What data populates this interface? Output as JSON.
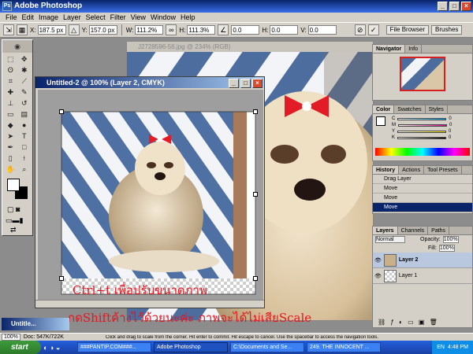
{
  "window": {
    "title": "Adobe Photoshop"
  },
  "menu": [
    "File",
    "Edit",
    "Image",
    "Layer",
    "Select",
    "Filter",
    "View",
    "Window",
    "Help"
  ],
  "options": {
    "x": "187.5 px",
    "y": "157.0 px",
    "w": "111.2%",
    "h": "111.3%",
    "angle": "0.0",
    "hskew": "0.0",
    "vskew": "0.0",
    "labels": {
      "x": "X:",
      "y": "Y:",
      "w": "W:",
      "h": "H:",
      "h_skew": "H:",
      "v_skew": "V:"
    },
    "tabs": [
      "File Browser",
      "Brushes"
    ]
  },
  "documents": {
    "background_title": "J2728596-56.jpg @ 234% (RGB)",
    "front_title": "Untitled-2 @ 100% (Layer 2, CMYK)",
    "minimized_title": "Untitle..."
  },
  "panels": {
    "navigator_tabs": [
      "Navigator",
      "Info"
    ],
    "color_tabs": [
      "Color",
      "Swatches",
      "Styles"
    ],
    "color_channels": [
      {
        "label": "C",
        "value": "0",
        "color": "#00a6e0"
      },
      {
        "label": "M",
        "value": "0",
        "color": "#e0008a"
      },
      {
        "label": "Y",
        "value": "0",
        "color": "#f0e000"
      },
      {
        "label": "K",
        "value": "0",
        "color": "#000000"
      }
    ],
    "history_tabs": [
      "History",
      "Actions",
      "Tool Presets"
    ],
    "history": [
      "Drag Layer",
      "Move",
      "Move",
      "Move"
    ],
    "layers_tabs": [
      "Layers",
      "Channels",
      "Paths"
    ],
    "blend_mode": "Normal",
    "opacity_label": "Opacity:",
    "opacity": "100%",
    "fill_label": "Fill:",
    "fill": "100%",
    "layers": [
      "Layer 2",
      "Layer 1"
    ]
  },
  "overlay": {
    "line1": "Ctrl+t เพื่อปรับขนาดภาพ",
    "line2": "กดShiftค้างไว้ด้วยนะค่ะ ภาพจะได้ไม่เสียScale"
  },
  "statusbar": {
    "zoom": "100%",
    "doc": "Doc: 547K/722K",
    "hint": "Click and drag to scale from the corner. Hit enter to commit. Hit escape to cancel. Use the spacebar to access the navigation tools."
  },
  "taskbar": {
    "start": "start",
    "items": [
      "###PANTIP.COM###...",
      "Adobe Photoshop",
      "C:\\Documents and Se...",
      "249. THE INNOCENT ..."
    ],
    "active_index": 1,
    "lang": "EN",
    "time": "4:48 PM"
  },
  "colors": {
    "accent": "#0a246a",
    "overlay_text": "#e8141e",
    "taskbar": "#245edb"
  }
}
